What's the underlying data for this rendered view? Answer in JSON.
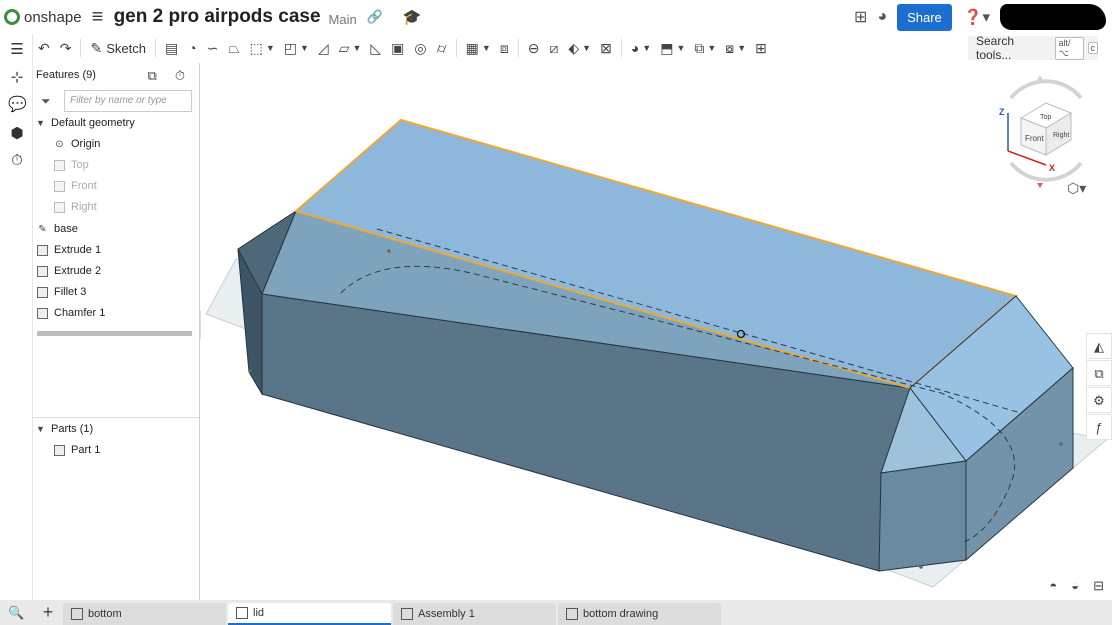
{
  "app": {
    "logo_text": "onshape",
    "doc_title": "gen 2 pro airpods case",
    "workspace": "Main",
    "share_label": "Share"
  },
  "toolbar": {
    "sketch_label": "Sketch",
    "search_label": "Search tools...",
    "search_kbd1": "alt/⌥",
    "search_kbd2": "c"
  },
  "features": {
    "header": "Features (9)",
    "filter_placeholder": "Filter by name or type",
    "default_geometry": "Default geometry",
    "origin": "Origin",
    "top": "Top",
    "front": "Front",
    "right": "Right",
    "items": [
      "base",
      "Extrude 1",
      "Extrude 2",
      "Fillet 3",
      "Chamfer 1"
    ],
    "parts_header": "Parts (1)",
    "part": "Part 1"
  },
  "viewcube": {
    "top": "Top",
    "front": "Front",
    "right": "Right",
    "axis_x": "X",
    "axis_z": "Z"
  },
  "tabs": [
    {
      "label": "bottom",
      "active": false
    },
    {
      "label": "lid",
      "active": true
    },
    {
      "label": "Assembly 1",
      "active": false
    },
    {
      "label": "bottom drawing",
      "active": false
    }
  ],
  "colors": {
    "accent": "#1c6fd1",
    "top_face": "#8db8dc",
    "side_dark": "#587487",
    "edge_highlight": "#f0a830"
  }
}
